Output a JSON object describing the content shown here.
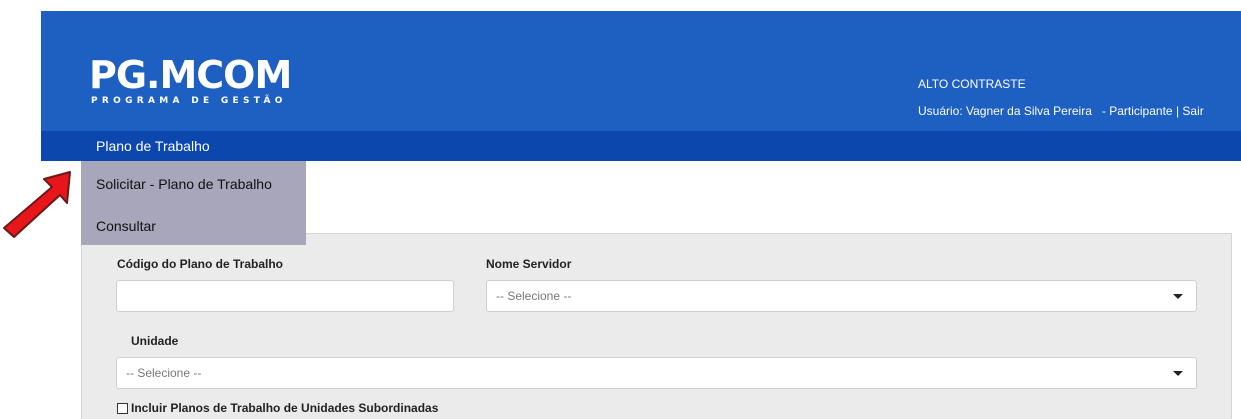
{
  "header": {
    "logo_main": "PG.MCOM",
    "logo_sub": "PROGRAMA DE GESTÃO",
    "contrast_link": "ALTO CONTRASTE",
    "user_prefix": "Usuário: Vagner da Silva Pereira",
    "user_role": "- Participante",
    "separator": "|",
    "logout": "Sair"
  },
  "nav": {
    "items": [
      {
        "label": "Plano de Trabalho"
      }
    ]
  },
  "dropdown": {
    "items": [
      {
        "label": "Solicitar - Plano de Trabalho"
      },
      {
        "label": "Consultar"
      }
    ]
  },
  "form": {
    "codigo_label": "Código do Plano de Trabalho",
    "codigo_value": "",
    "servidor_label": "Nome Servidor",
    "servidor_value": "-- Selecione --",
    "unidade_label": "Unidade",
    "unidade_value": "-- Selecione --",
    "checkbox_label": "Incluir Planos de Trabalho de Unidades Subordinadas",
    "checkbox_checked": false
  },
  "colors": {
    "header_bg": "#1e5fc2",
    "nav_bg": "#0b47ad",
    "dropdown_bg": "#a7a6bb",
    "arrow": "#e8161b"
  },
  "icons": {
    "arrow": "red-pointer-arrow-icon",
    "caret": "caret-down-icon"
  }
}
